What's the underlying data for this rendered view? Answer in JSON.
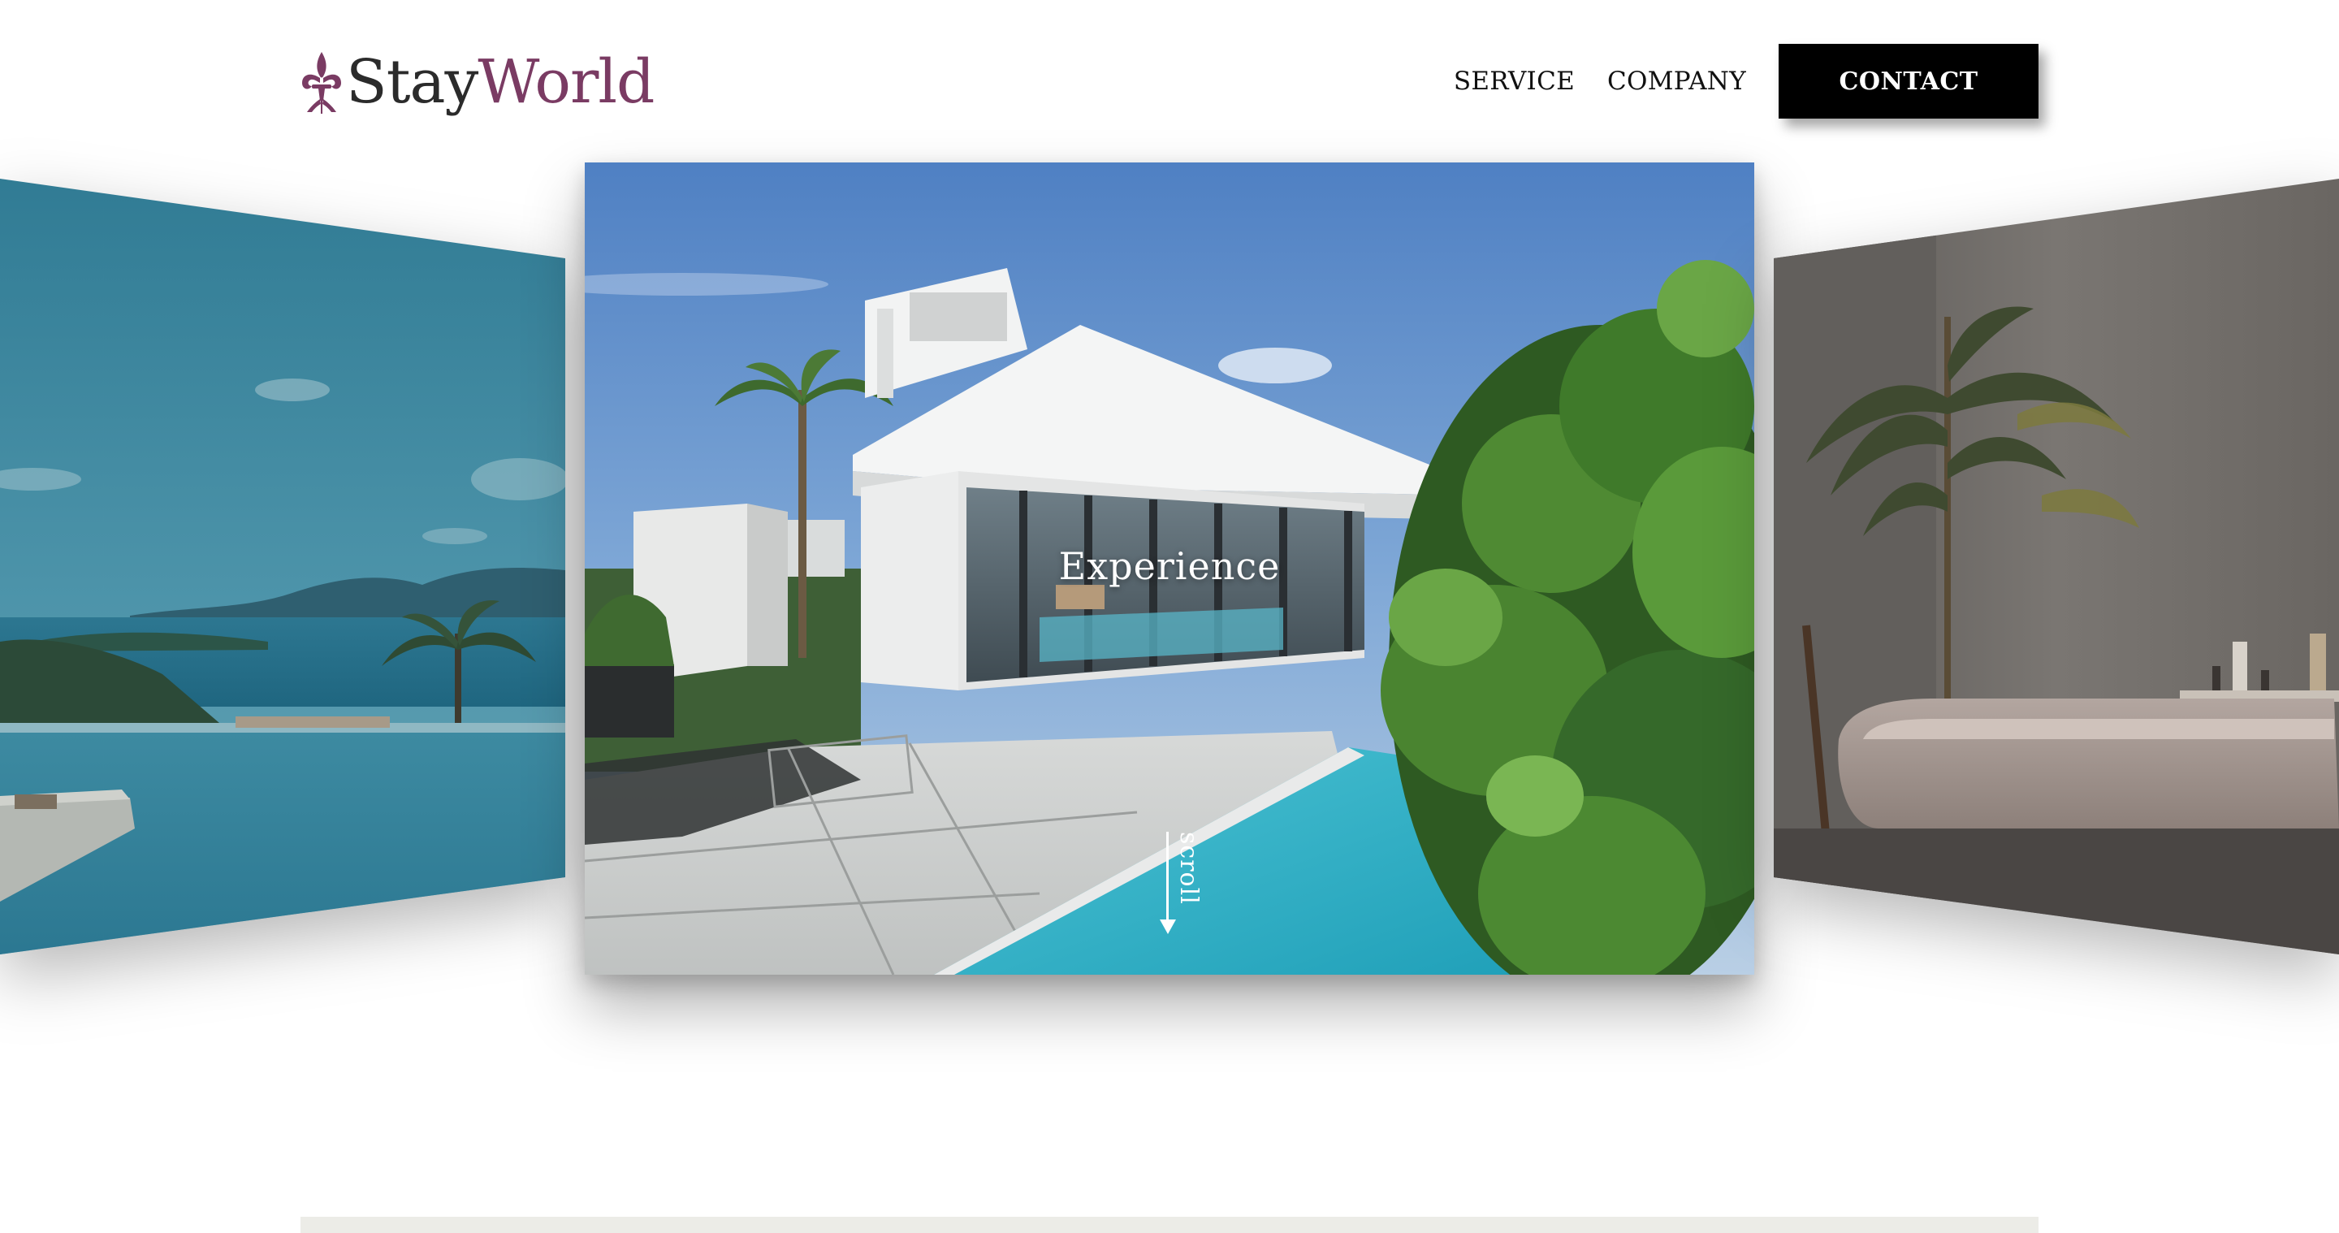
{
  "brand": {
    "name_part1": "Stay",
    "name_part2": "World",
    "logo_icon": "fleur-de-lis-icon",
    "colors": {
      "stay": "#2b2b2b",
      "world": "#7a3b63"
    }
  },
  "nav": {
    "links": [
      {
        "label": "SERVICE"
      },
      {
        "label": "COMPANY"
      }
    ],
    "contact_label": "CONTACT"
  },
  "carousel": {
    "slides": [
      {
        "position": "left",
        "scene": "ocean-infinity-pool"
      },
      {
        "position": "center",
        "scene": "modern-villa-with-pool",
        "title": "Experience"
      },
      {
        "position": "right",
        "scene": "outdoor-bathtub-with-palm"
      }
    ],
    "scroll_label": "scroll",
    "scroll_icon": "arrow-down-icon"
  },
  "colors": {
    "button_bg": "#000000",
    "button_text": "#ffffff",
    "band": "#ecece7"
  }
}
